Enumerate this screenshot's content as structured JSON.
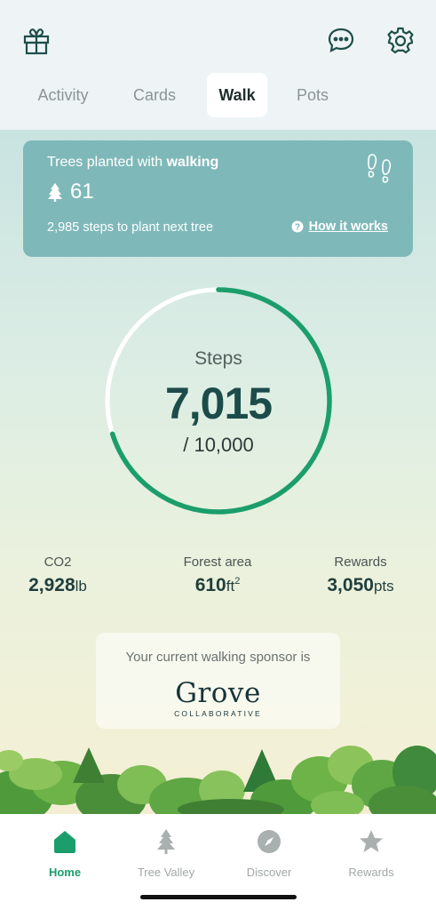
{
  "header": {
    "icons": {
      "gift": "gift-icon",
      "chat": "chat-bubble-icon",
      "settings": "gear-icon"
    }
  },
  "tabs": [
    {
      "label": "Activity",
      "active": false
    },
    {
      "label": "Cards",
      "active": false
    },
    {
      "label": "Walk",
      "active": true
    },
    {
      "label": "Pots",
      "active": false
    }
  ],
  "walk_card": {
    "title_prefix": "Trees planted with ",
    "title_bold": "walking",
    "tree_count": "61",
    "steps_to_next": "2,985 steps to plant next tree",
    "how_it_works": "How it works"
  },
  "steps": {
    "label": "Steps",
    "value": "7,015",
    "goal": "/ 10,000",
    "progress": 0.7015
  },
  "stats": {
    "co2": {
      "label": "CO2",
      "value": "2,928",
      "unit": "lb"
    },
    "forest": {
      "label": "Forest area",
      "value": "610",
      "unit": "ft",
      "exp": "2"
    },
    "rewards": {
      "label": "Rewards",
      "value": "3,050",
      "unit": "pts"
    }
  },
  "sponsor": {
    "text": "Your current walking sponsor is",
    "logo": "Grove",
    "logo_sub": "COLLABORATIVE"
  },
  "nav": [
    {
      "label": "Home",
      "icon": "home-icon",
      "active": true
    },
    {
      "label": "Tree Valley",
      "icon": "tree-icon",
      "active": false
    },
    {
      "label": "Discover",
      "icon": "compass-icon",
      "active": false
    },
    {
      "label": "Rewards",
      "icon": "star-icon",
      "active": false
    }
  ],
  "colors": {
    "accent": "#1b9e6b",
    "ring_track": "#ffffff",
    "card": "#7fb8b9",
    "steps_value": "#1c4c4a"
  }
}
